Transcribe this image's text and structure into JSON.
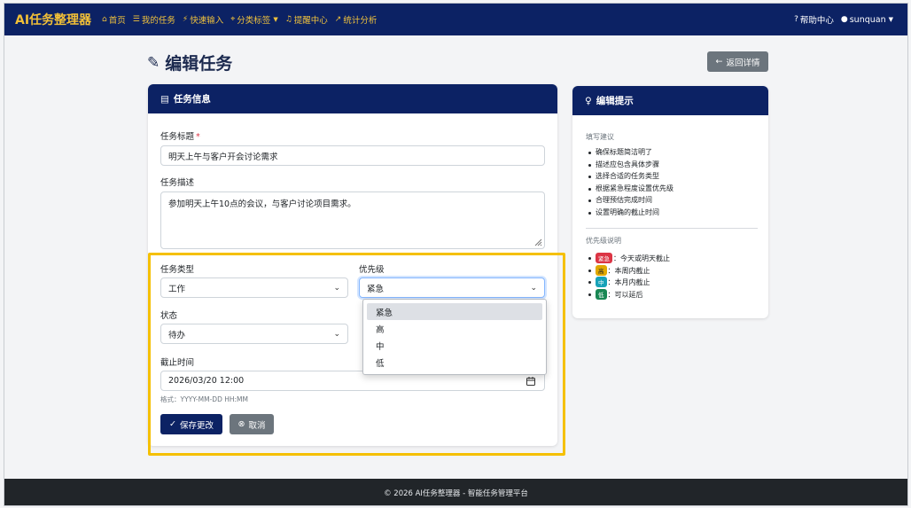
{
  "navbar": {
    "brand": "AI任务整理器",
    "items": [
      {
        "label": "首页",
        "icon": "home-icon"
      },
      {
        "label": "我的任务",
        "icon": "list-icon"
      },
      {
        "label": "快速输入",
        "icon": "lightning-icon"
      },
      {
        "label": "分类标签",
        "icon": "tag-icon"
      },
      {
        "label": "提醒中心",
        "icon": "bell-icon"
      },
      {
        "label": "统计分析",
        "icon": "chart-icon"
      }
    ],
    "help_label": "帮助中心",
    "user_label": "sunquan"
  },
  "page": {
    "title": "编辑任务",
    "back_label": "返回详情"
  },
  "form": {
    "header": "任务信息",
    "title_label": "任务标题",
    "title_value": "明天上午与客户开会讨论需求",
    "desc_label": "任务描述",
    "desc_value": "参加明天上午10点的会议，与客户讨论项目需求。",
    "type_label": "任务类型",
    "type_value": "工作",
    "priority_label": "优先级",
    "priority_value": "紧急",
    "priority_options": [
      "紧急",
      "高",
      "中",
      "低"
    ],
    "status_label": "状态",
    "status_value": "待办",
    "deadline_label": "截止时间",
    "deadline_value": "2026/03/20  12:00",
    "deadline_help": "格式：YYYY-MM-DD HH:MM",
    "save_label": "保存更改",
    "cancel_label": "取消"
  },
  "tips": {
    "header": "编辑提示",
    "section1": "填写建议",
    "items": [
      "确保标题简洁明了",
      "描述应包含具体步骤",
      "选择合适的任务类型",
      "根据紧急程度设置优先级",
      "合理预估完成时间",
      "设置明确的截止时间"
    ],
    "section2": "优先级说明",
    "priority_items": [
      {
        "badge": "紧急",
        "text": "：今天或明天截止",
        "color": "#dc3545"
      },
      {
        "badge": "高",
        "text": "：本周内截止",
        "color": "#e0a800"
      },
      {
        "badge": "中",
        "text": "：本月内截止",
        "color": "#17a2b8"
      },
      {
        "badge": "低",
        "text": "：可以延后",
        "color": "#198754"
      }
    ]
  },
  "footer": "© 2026 AI任务整理器 - 智能任务管理平台",
  "colors": {
    "navbar": "#0c2264",
    "accent": "#f2c037",
    "highlight": "#f5c000"
  }
}
